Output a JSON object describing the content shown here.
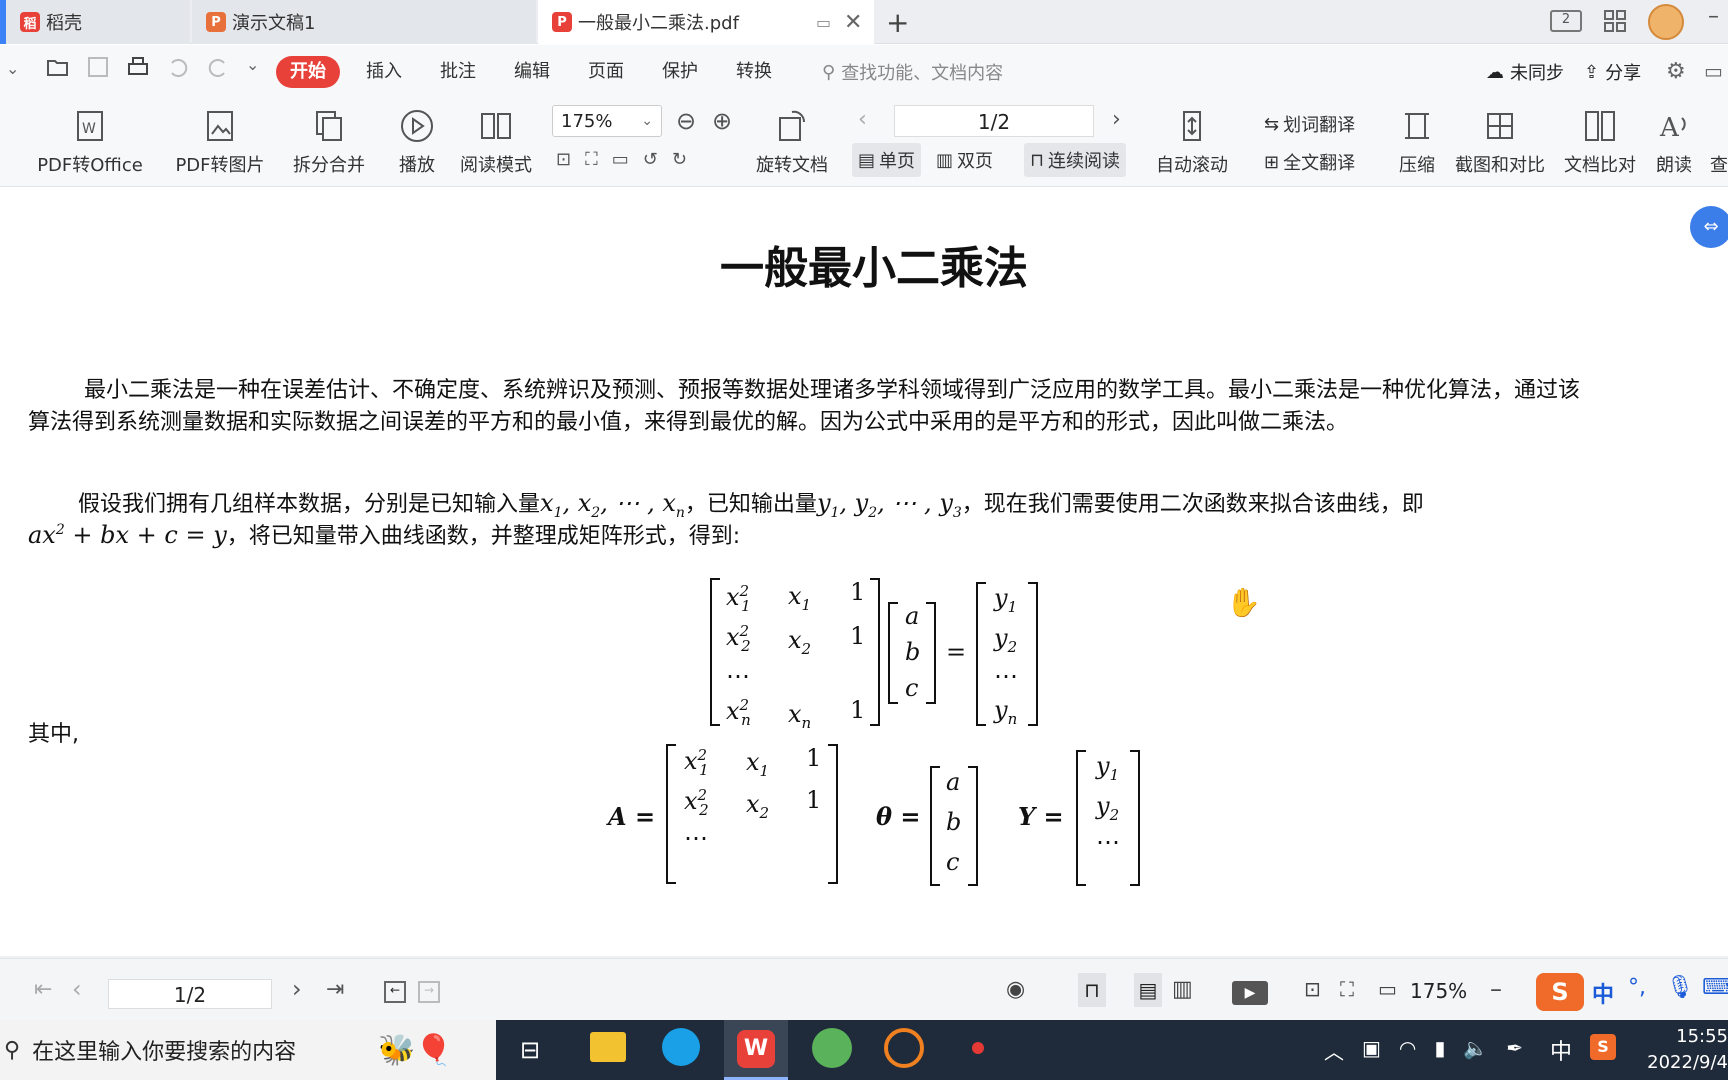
{
  "tabs": [
    {
      "label": "稻壳",
      "icon": "docer-icon"
    },
    {
      "label": "演示文稿1",
      "icon": "presentation-icon"
    },
    {
      "label": "一般最小二乘法.pdf",
      "icon": "pdf-icon"
    }
  ],
  "menu": {
    "items": [
      "开始",
      "插入",
      "批注",
      "编辑",
      "页面",
      "保护",
      "转换"
    ],
    "search_placeholder": "查找功能、文档内容",
    "sync": "未同步",
    "share": "分享"
  },
  "ribbon": {
    "pdf_to_office": "PDF转Office",
    "pdf_to_image": "PDF转图片",
    "split_merge": "拆分合并",
    "play": "播放",
    "read_mode": "阅读模式",
    "zoom": "175%",
    "rotate": "旋转文档",
    "page": "1/2",
    "single": "单页",
    "double": "双页",
    "continuous": "连续阅读",
    "auto_scroll": "自动滚动",
    "word_translate": "划词翻译",
    "full_translate": "全文翻译",
    "compress": "压缩",
    "screenshot_compare": "截图和对比",
    "doc_compare": "文档比对",
    "read_aloud": "朗读",
    "more": "查"
  },
  "document": {
    "title": "一般最小二乘法",
    "para1_line1": "最小二乘法是一种在误差估计、不确定度、系统辨识及预测、预报等数据处理诸多学科领域得到广泛应用的数学工具。最小二乘法是一种优化算法，通过该",
    "para1_line2": "算法得到系统测量数据和实际数据之间误差的平方和的最小值，来得到最优的解。因为公式中采用的是平方和的形式，因此叫做二乘法。",
    "para2_a": "假设我们拥有几组样本数据，分别是已知输入量",
    "para2_b": "，已知输出量",
    "para2_c": "，现在我们需要使用二次函数来拟合该曲线，即",
    "para2_d": "，将已知量带入曲线函数，并整理成矩阵形式，得到:",
    "where": "其中,"
  },
  "statusbar": {
    "page": "1/2",
    "zoom": "175%"
  },
  "taskbar": {
    "search_placeholder": "在这里输入你要搜索的内容",
    "ime": "中",
    "time": "15:55",
    "date": "2022/9/4"
  },
  "colors": {
    "accent": "#e8413a",
    "taskbar": "#1f2b3a"
  }
}
